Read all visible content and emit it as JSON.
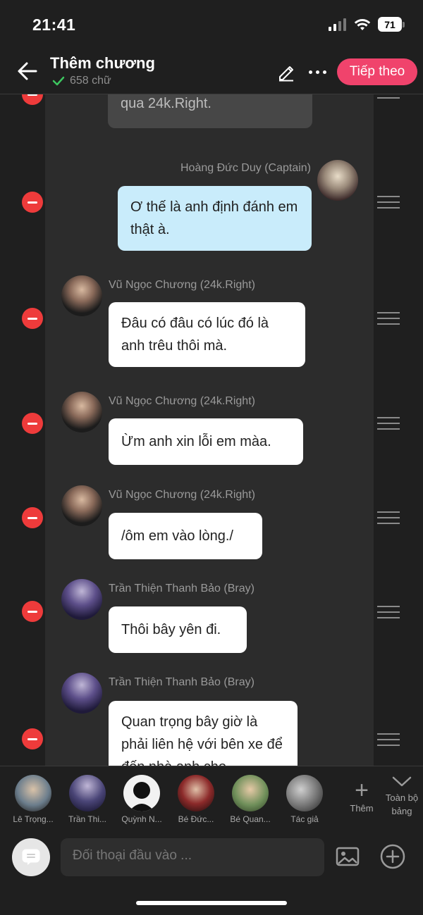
{
  "status": {
    "time": "21:41",
    "battery": "71"
  },
  "header": {
    "title": "Thêm chương",
    "word_count": "658 chữ",
    "next_label": "Tiếp theo"
  },
  "messages": [
    {
      "sender": "",
      "text": "qua 24k.Right.",
      "style": "gray"
    },
    {
      "sender": "Hoàng Đức Duy (Captain)",
      "text": "Ơ thế là anh định đánh em thật à.",
      "style": "blue"
    },
    {
      "sender": "Vũ Ngọc Chương (24k.Right)",
      "text": "Đâu có đâu có lúc đó là anh trêu thôi mà.",
      "style": "white"
    },
    {
      "sender": "Vũ Ngọc Chương (24k.Right)",
      "text": "Ừm anh xin lỗi em màa.",
      "style": "white"
    },
    {
      "sender": "Vũ Ngọc Chương (24k.Right)",
      "text": "/ôm em vào lòng./",
      "style": "white"
    },
    {
      "sender": "Trần Thiện Thanh Bảo (Bray)",
      "text": "Thôi bây yên đi.",
      "style": "white"
    },
    {
      "sender": "Trần Thiện Thanh Bảo (Bray)",
      "text": "Quan trọng bây giờ là phải liên hệ với bên xe để đến nhà anh cho",
      "style": "white"
    }
  ],
  "characters": [
    {
      "name": "Lê Trọng...",
      "color": "#6b7d8c"
    },
    {
      "name": "Trần Thi...",
      "color": "#4a4577"
    },
    {
      "name": "Quỳnh N...",
      "color": "#111111"
    },
    {
      "name": "Bé Đức...",
      "color": "#8c2a2a"
    },
    {
      "name": "Bé Quan...",
      "color": "#6f8f5a"
    },
    {
      "name": "Tác giả",
      "color": "#7a7a7a"
    }
  ],
  "char_actions": {
    "add_label": "Thêm",
    "all_label": "Toàn bộ bảng"
  },
  "input": {
    "placeholder": "Đối thoại đầu vào ..."
  }
}
